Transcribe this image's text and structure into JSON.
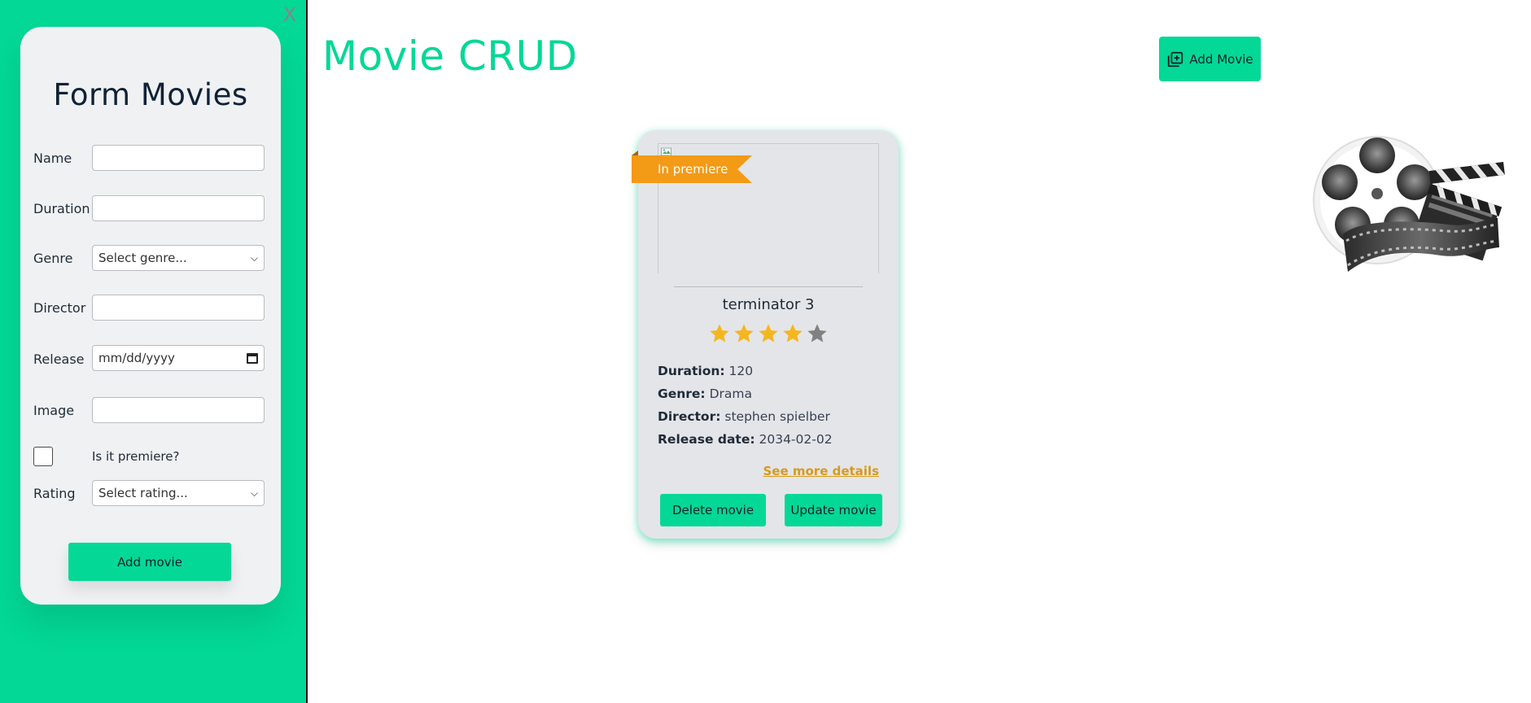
{
  "sidebar": {
    "close_label": "X",
    "form_title": "Form Movies",
    "fields": {
      "name": {
        "label": "Name",
        "value": ""
      },
      "duration": {
        "label": "Duration",
        "value": ""
      },
      "genre": {
        "label": "Genre",
        "value": "Select genre..."
      },
      "director": {
        "label": "Director",
        "value": ""
      },
      "release": {
        "label": "Release",
        "placeholder": "mm/dd/yyyy"
      },
      "image": {
        "label": "Image",
        "value": ""
      },
      "premiere": {
        "label": "Is it premiere?",
        "checked": false
      },
      "rating": {
        "label": "Rating",
        "value": "Select rating..."
      }
    },
    "submit_label": "Add movie"
  },
  "header": {
    "title": "Movie CRUD",
    "add_button_label": "Add Movie"
  },
  "movie": {
    "badge": "In premiere",
    "title": "terminator 3",
    "rating": 4,
    "rating_max": 5,
    "duration_label": "Duration:",
    "duration": "120",
    "genre_label": "Genre:",
    "genre": "Drama",
    "director_label": "Director:",
    "director": "stephen spielber",
    "release_label": "Release date:",
    "release": "2034-02-02",
    "more_link": "See more details",
    "delete_label": "Delete movie",
    "update_label": "Update movie"
  },
  "colors": {
    "accent": "#03d896",
    "ribbon": "#f39a17",
    "star_on": "#f4b620",
    "star_off": "#808080",
    "link": "#d89a1a"
  }
}
